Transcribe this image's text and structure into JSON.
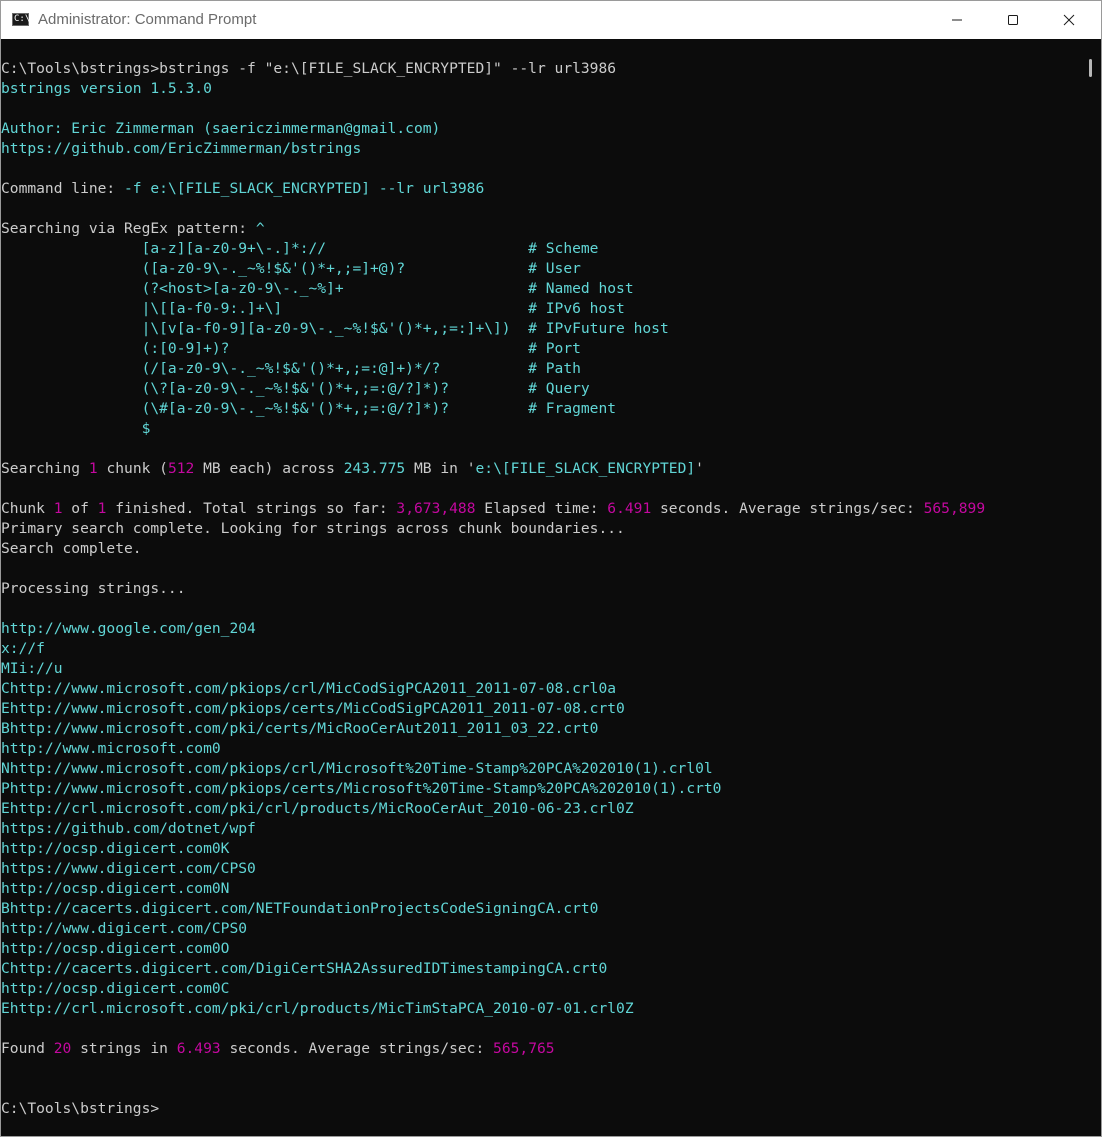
{
  "window": {
    "title": "Administrator: Command Prompt",
    "icon": "cmd-icon",
    "icon_text": "C:\\",
    "buttons": [
      "minimize-icon",
      "maximize-icon",
      "close-icon"
    ]
  },
  "colors": {
    "background": "#0c0c0c",
    "default_text": "#cccccc",
    "cyan": "#61d6d6",
    "magenta": "#c4089f"
  },
  "console": {
    "lines": [
      [
        [
          "w",
          "C:\\Tools\\bstrings>bstrings -f \"e:\\[FILE_SLACK_ENCRYPTED]\" --lr url3986"
        ]
      ],
      [
        [
          "c",
          "bstrings version 1.5.3.0"
        ]
      ],
      [],
      [
        [
          "c",
          "Author: Eric Zimmerman (saericzimmerman@gmail.com)"
        ]
      ],
      [
        [
          "c",
          "https://github.com/EricZimmerman/bstrings"
        ]
      ],
      [],
      [
        [
          "w",
          "Command line: "
        ],
        [
          "c",
          "-f e:\\[FILE_SLACK_ENCRYPTED] --lr url3986"
        ]
      ],
      [],
      [
        [
          "w",
          "Searching via RegEx pattern: "
        ],
        [
          "c",
          "^"
        ]
      ],
      [
        [
          "c",
          "                [a-z][a-z0-9+\\-.]*://                       # Scheme"
        ]
      ],
      [
        [
          "c",
          "                ([a-z0-9\\-._~%!$&'()*+,;=]+@)?              # User"
        ]
      ],
      [
        [
          "c",
          "                (?<host>[a-z0-9\\-._~%]+                     # Named host"
        ]
      ],
      [
        [
          "c",
          "                |\\[[a-f0-9:.]+\\]                            # IPv6 host"
        ]
      ],
      [
        [
          "c",
          "                |\\[v[a-f0-9][a-z0-9\\-._~%!$&'()*+,;=:]+\\])  # IPvFuture host"
        ]
      ],
      [
        [
          "c",
          "                (:[0-9]+)?                                  # Port"
        ]
      ],
      [
        [
          "c",
          "                (/[a-z0-9\\-._~%!$&'()*+,;=:@]+)*/?          # Path"
        ]
      ],
      [
        [
          "c",
          "                (\\?[a-z0-9\\-._~%!$&'()*+,;=:@/?]*)?         # Query"
        ]
      ],
      [
        [
          "c",
          "                (\\#[a-z0-9\\-._~%!$&'()*+,;=:@/?]*)?         # Fragment"
        ]
      ],
      [
        [
          "c",
          "                $"
        ]
      ],
      [],
      [
        [
          "w",
          "Searching "
        ],
        [
          "m",
          "1"
        ],
        [
          "w",
          " chunk ("
        ],
        [
          "m",
          "512"
        ],
        [
          "w",
          " MB each) across "
        ],
        [
          "c",
          "243.775"
        ],
        [
          "w",
          " MB in '"
        ],
        [
          "c",
          "e:\\[FILE_SLACK_ENCRYPTED]"
        ],
        [
          "w",
          "'"
        ]
      ],
      [],
      [
        [
          "w",
          "Chunk "
        ],
        [
          "m",
          "1"
        ],
        [
          "w",
          " of "
        ],
        [
          "m",
          "1"
        ],
        [
          "w",
          " finished. Total strings so far: "
        ],
        [
          "m",
          "3,673,488"
        ],
        [
          "w",
          " Elapsed time: "
        ],
        [
          "m",
          "6.491"
        ],
        [
          "w",
          " seconds. Average strings/sec: "
        ],
        [
          "m",
          "565,899"
        ]
      ],
      [
        [
          "w",
          "Primary search complete. Looking for strings across chunk boundaries..."
        ]
      ],
      [
        [
          "w",
          "Search complete."
        ]
      ],
      [],
      [
        [
          "w",
          "Processing strings..."
        ]
      ],
      [],
      [
        [
          "c",
          "http://www.google.com/gen_204"
        ]
      ],
      [
        [
          "c",
          "x://f"
        ]
      ],
      [
        [
          "c",
          "MIi://u"
        ]
      ],
      [
        [
          "c",
          "Chttp://www.microsoft.com/pkiops/crl/MicCodSigPCA2011_2011-07-08.crl0a"
        ]
      ],
      [
        [
          "c",
          "Ehttp://www.microsoft.com/pkiops/certs/MicCodSigPCA2011_2011-07-08.crt0"
        ]
      ],
      [
        [
          "c",
          "Bhttp://www.microsoft.com/pki/certs/MicRooCerAut2011_2011_03_22.crt0"
        ]
      ],
      [
        [
          "c",
          "http://www.microsoft.com0"
        ]
      ],
      [
        [
          "c",
          "Nhttp://www.microsoft.com/pkiops/crl/Microsoft%20Time-Stamp%20PCA%202010(1).crl0l"
        ]
      ],
      [
        [
          "c",
          "Phttp://www.microsoft.com/pkiops/certs/Microsoft%20Time-Stamp%20PCA%202010(1).crt0"
        ]
      ],
      [
        [
          "c",
          "Ehttp://crl.microsoft.com/pki/crl/products/MicRooCerAut_2010-06-23.crl0Z"
        ]
      ],
      [
        [
          "c",
          "https://github.com/dotnet/wpf"
        ]
      ],
      [
        [
          "c",
          "http://ocsp.digicert.com0K"
        ]
      ],
      [
        [
          "c",
          "https://www.digicert.com/CPS0"
        ]
      ],
      [
        [
          "c",
          "http://ocsp.digicert.com0N"
        ]
      ],
      [
        [
          "c",
          "Bhttp://cacerts.digicert.com/NETFoundationProjectsCodeSigningCA.crt0"
        ]
      ],
      [
        [
          "c",
          "http://www.digicert.com/CPS0"
        ]
      ],
      [
        [
          "c",
          "http://ocsp.digicert.com0O"
        ]
      ],
      [
        [
          "c",
          "Chttp://cacerts.digicert.com/DigiCertSHA2AssuredIDTimestampingCA.crt0"
        ]
      ],
      [
        [
          "c",
          "http://ocsp.digicert.com0C"
        ]
      ],
      [
        [
          "c",
          "Ehttp://crl.microsoft.com/pki/crl/products/MicTimStaPCA_2010-07-01.crl0Z"
        ]
      ],
      [],
      [
        [
          "w",
          "Found "
        ],
        [
          "m",
          "20"
        ],
        [
          "w",
          " strings in "
        ],
        [
          "m",
          "6.493"
        ],
        [
          "w",
          " seconds. Average strings/sec: "
        ],
        [
          "m",
          "565,765"
        ]
      ],
      [],
      [],
      [
        [
          "w",
          "C:\\Tools\\bstrings>"
        ]
      ]
    ]
  }
}
